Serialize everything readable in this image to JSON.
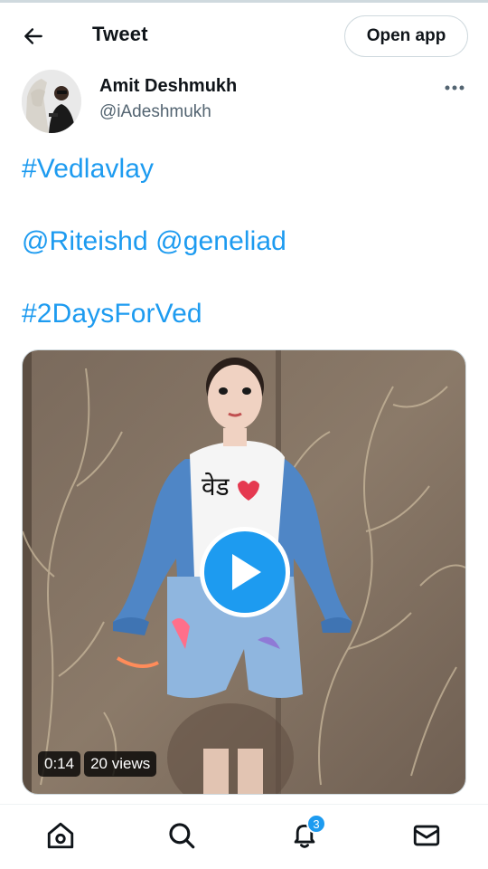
{
  "header": {
    "title": "Tweet",
    "open_app_label": "Open app",
    "back_icon": "arrow-left-icon"
  },
  "author": {
    "name": "Amit Deshmukh",
    "handle": "@iAdeshmukh"
  },
  "tweet": {
    "lines": [
      "#Vedlavlay",
      "@Riteishd @geneliad",
      "#2DaysForVed"
    ]
  },
  "media": {
    "type": "video",
    "duration": "0:14",
    "views": "20 views",
    "shirt_text": "वेड"
  },
  "bottom_nav": {
    "items": [
      "home-icon",
      "search-icon",
      "notifications-icon",
      "messages-icon"
    ],
    "notification_count": "3"
  },
  "colors": {
    "accent": "#1d9bf0",
    "text": "#0f1419",
    "secondary": "#536471",
    "border": "#cfd9de"
  }
}
